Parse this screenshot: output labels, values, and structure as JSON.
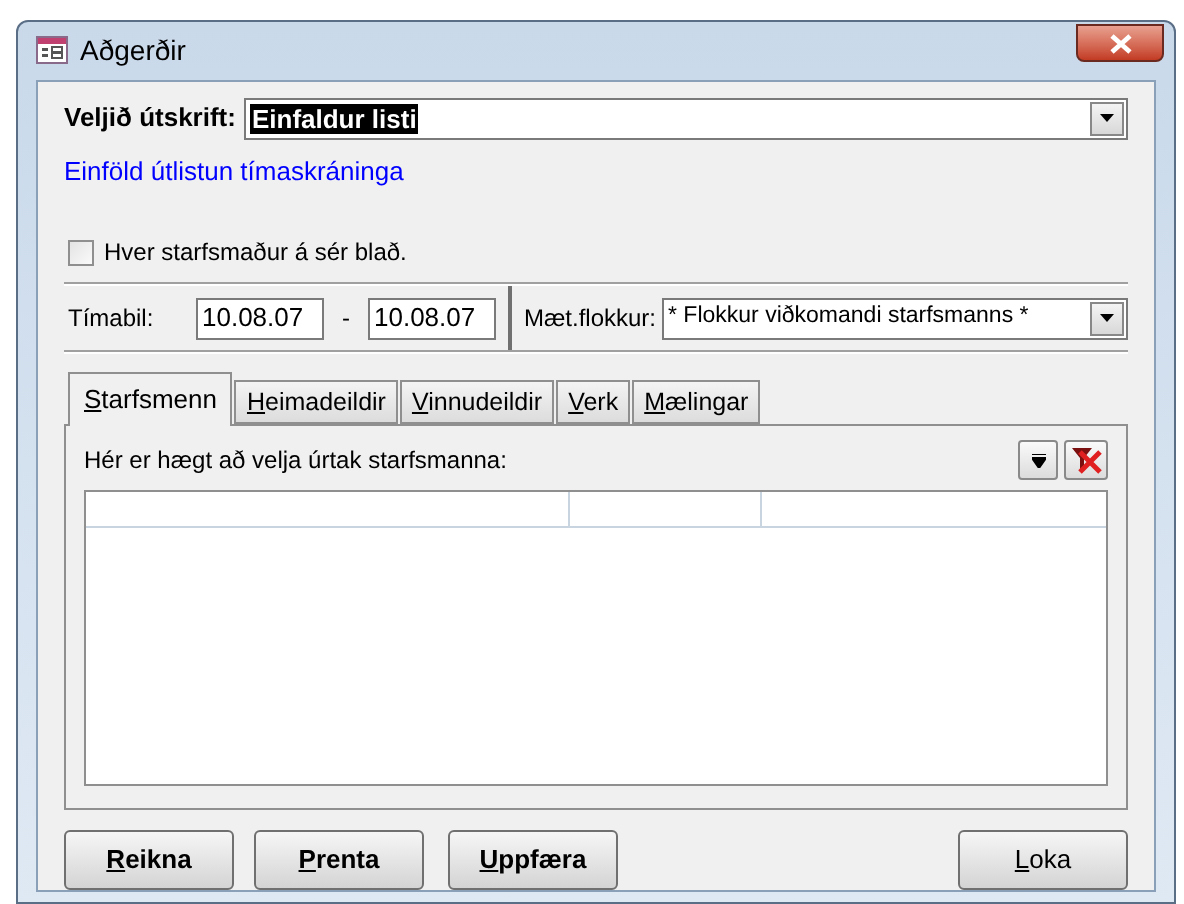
{
  "window": {
    "title": "Aðgerðir"
  },
  "report": {
    "label": "Veljið útskrift:",
    "value": "Einfaldur listi",
    "description": "Einföld útlistun tímaskráninga"
  },
  "per_employee_sheet": {
    "label": "Hver starfsmaður á sér blað.",
    "checked": false
  },
  "period": {
    "label": "Tímabil:",
    "from": "10.08.07",
    "separator": "-",
    "to": "10.08.07"
  },
  "attendance_group": {
    "label": "Mæt.flokkur:",
    "value": "* Flokkur viðkomandi starfsmanns *"
  },
  "tabs": [
    {
      "label": "Starfsmenn",
      "selected": true
    },
    {
      "label": "Heimadeildir",
      "selected": false
    },
    {
      "label": "Vinnudeildir",
      "selected": false
    },
    {
      "label": "Verk",
      "selected": false
    },
    {
      "label": "Mælingar",
      "selected": false
    }
  ],
  "panel": {
    "instruction": "Hér er hægt að velja úrtak starfsmanna:"
  },
  "buttons": [
    {
      "label": "Reikna"
    },
    {
      "label": "Prenta"
    },
    {
      "label": "Uppfæra"
    },
    {
      "label": "Loka",
      "kind": "plain"
    }
  ]
}
